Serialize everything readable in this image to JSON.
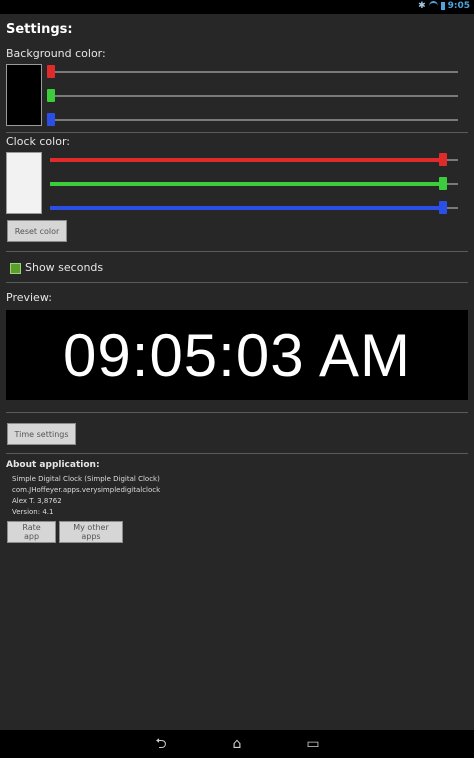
{
  "status_bar": {
    "time": "9:05",
    "bluetooth_glyph": "✱"
  },
  "settings": {
    "title": "Settings:",
    "background_label": "Background color:",
    "clock_label": "Clock color:",
    "background_color": {
      "r": 0,
      "g": 0,
      "b": 0
    },
    "clock_color": {
      "r": 255,
      "g": 255,
      "b": 255
    },
    "reset_button": "Reset color",
    "show_seconds_label": "Show seconds",
    "show_seconds_checked": true
  },
  "preview": {
    "label": "Preview:",
    "clock_text": "09:05:03 AM"
  },
  "time_settings_button": "Time settings",
  "about": {
    "title": "About application:",
    "lines": [
      "Simple Digital Clock (Simple Digital Clock)",
      "com.JHoffeyer.apps.verysimpledigitalclock",
      "Alex T. 3,8762",
      "Version: 4.1"
    ],
    "rate_button": "Rate app",
    "other_apps_button": "My other apps"
  },
  "colors": {
    "red": "#e02b2b",
    "green": "#3ccd3c",
    "blue": "#2b4fe6",
    "track_gray": "#7a7a7a"
  }
}
